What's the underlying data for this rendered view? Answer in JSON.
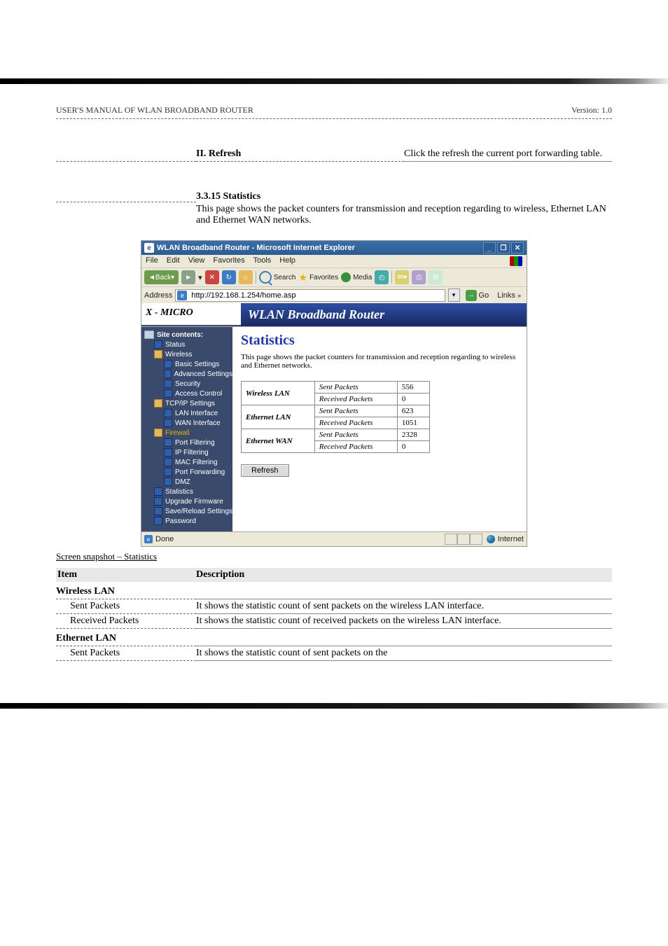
{
  "doc": {
    "guide_name": "USER'S MANUAL OF WLAN BROADBAND ROUTER",
    "version": "Version: 1.0",
    "section": "II. Refresh",
    "refresh_desc": "Click the refresh the current port forwarding table."
  },
  "fig": {
    "caption": "Screen snapshot – Statistics"
  },
  "browser": {
    "title": "WLAN Broadband Router - Microsoft Internet Explorer",
    "menu": {
      "file": "File",
      "edit": "Edit",
      "view": "View",
      "favorites": "Favorites",
      "tools": "Tools",
      "help": "Help"
    },
    "toolbar": {
      "back": "Back",
      "search": "Search",
      "favorites": "Favorites",
      "media": "Media"
    },
    "address_label": "Address",
    "url": "http://192.168.1.254/home.asp",
    "go": "Go",
    "links": "Links",
    "status_done": "Done",
    "status_zone": "Internet"
  },
  "brand": {
    "logo": "X - MICRO",
    "title": "WLAN Broadband Router"
  },
  "nav": {
    "root": "Site contents:",
    "status": "Status",
    "wireless": "Wireless",
    "basic": "Basic Settings",
    "advanced": "Advanced Settings",
    "security": "Security",
    "access": "Access Control",
    "tcpip": "TCP/IP Settings",
    "lan": "LAN Interface",
    "wan": "WAN Interface",
    "firewall": "Firewall",
    "portfilter": "Port Filtering",
    "ipfilter": "IP Filtering",
    "macfilter": "MAC Filtering",
    "portfwd": "Port Forwarding",
    "dmz": "DMZ",
    "stats": "Statistics",
    "upgrade": "Upgrade Firmware",
    "savereload": "Save/Reload Settings",
    "password": "Password"
  },
  "page": {
    "title": "Statistics",
    "desc": "This page shows the packet counters for transmission and reception regarding to wireless and Ethernet networks.",
    "rows": {
      "wlan_label": "Wireless LAN",
      "wlan_sent_l": "Sent Packets",
      "wlan_sent_v": "556",
      "wlan_recv_l": "Received Packets",
      "wlan_recv_v": "0",
      "elan_label": "Ethernet LAN",
      "elan_sent_l": "Sent Packets",
      "elan_sent_v": "623",
      "elan_recv_l": "Received Packets",
      "elan_recv_v": "1051",
      "ewan_label": "Ethernet WAN",
      "ewan_sent_l": "Sent Packets",
      "ewan_sent_v": "2328",
      "ewan_recv_l": "Received Packets",
      "ewan_recv_v": "0"
    },
    "refresh_btn": "Refresh"
  },
  "fields": {
    "header_item": "Item",
    "header_desc": "Description",
    "wlan": {
      "name": "Wireless LAN",
      "sent": {
        "label": "Sent Packets",
        "desc": "It shows the statistic count of sent packets on the wireless LAN interface."
      },
      "recv": {
        "label": "Received Packets",
        "desc": "It shows the statistic count of received packets on the wireless LAN interface."
      }
    },
    "elan": {
      "name": "Ethernet LAN",
      "sent": {
        "label": "Sent Packets",
        "desc": "It shows the statistic count of sent packets on the"
      }
    }
  },
  "sections": {
    "heading_3_3_15": "3.3.15 Statistics",
    "heading_3_3_15_desc": "This page shows the packet counters for transmission and reception regarding to wireless, Ethernet LAN and Ethernet WAN networks."
  },
  "chart_data": {
    "type": "table",
    "title": "Statistics",
    "series": [
      {
        "name": "Wireless LAN",
        "values": {
          "Sent Packets": 556,
          "Received Packets": 0
        }
      },
      {
        "name": "Ethernet LAN",
        "values": {
          "Sent Packets": 623,
          "Received Packets": 1051
        }
      },
      {
        "name": "Ethernet WAN",
        "values": {
          "Sent Packets": 2328,
          "Received Packets": 0
        }
      }
    ]
  }
}
